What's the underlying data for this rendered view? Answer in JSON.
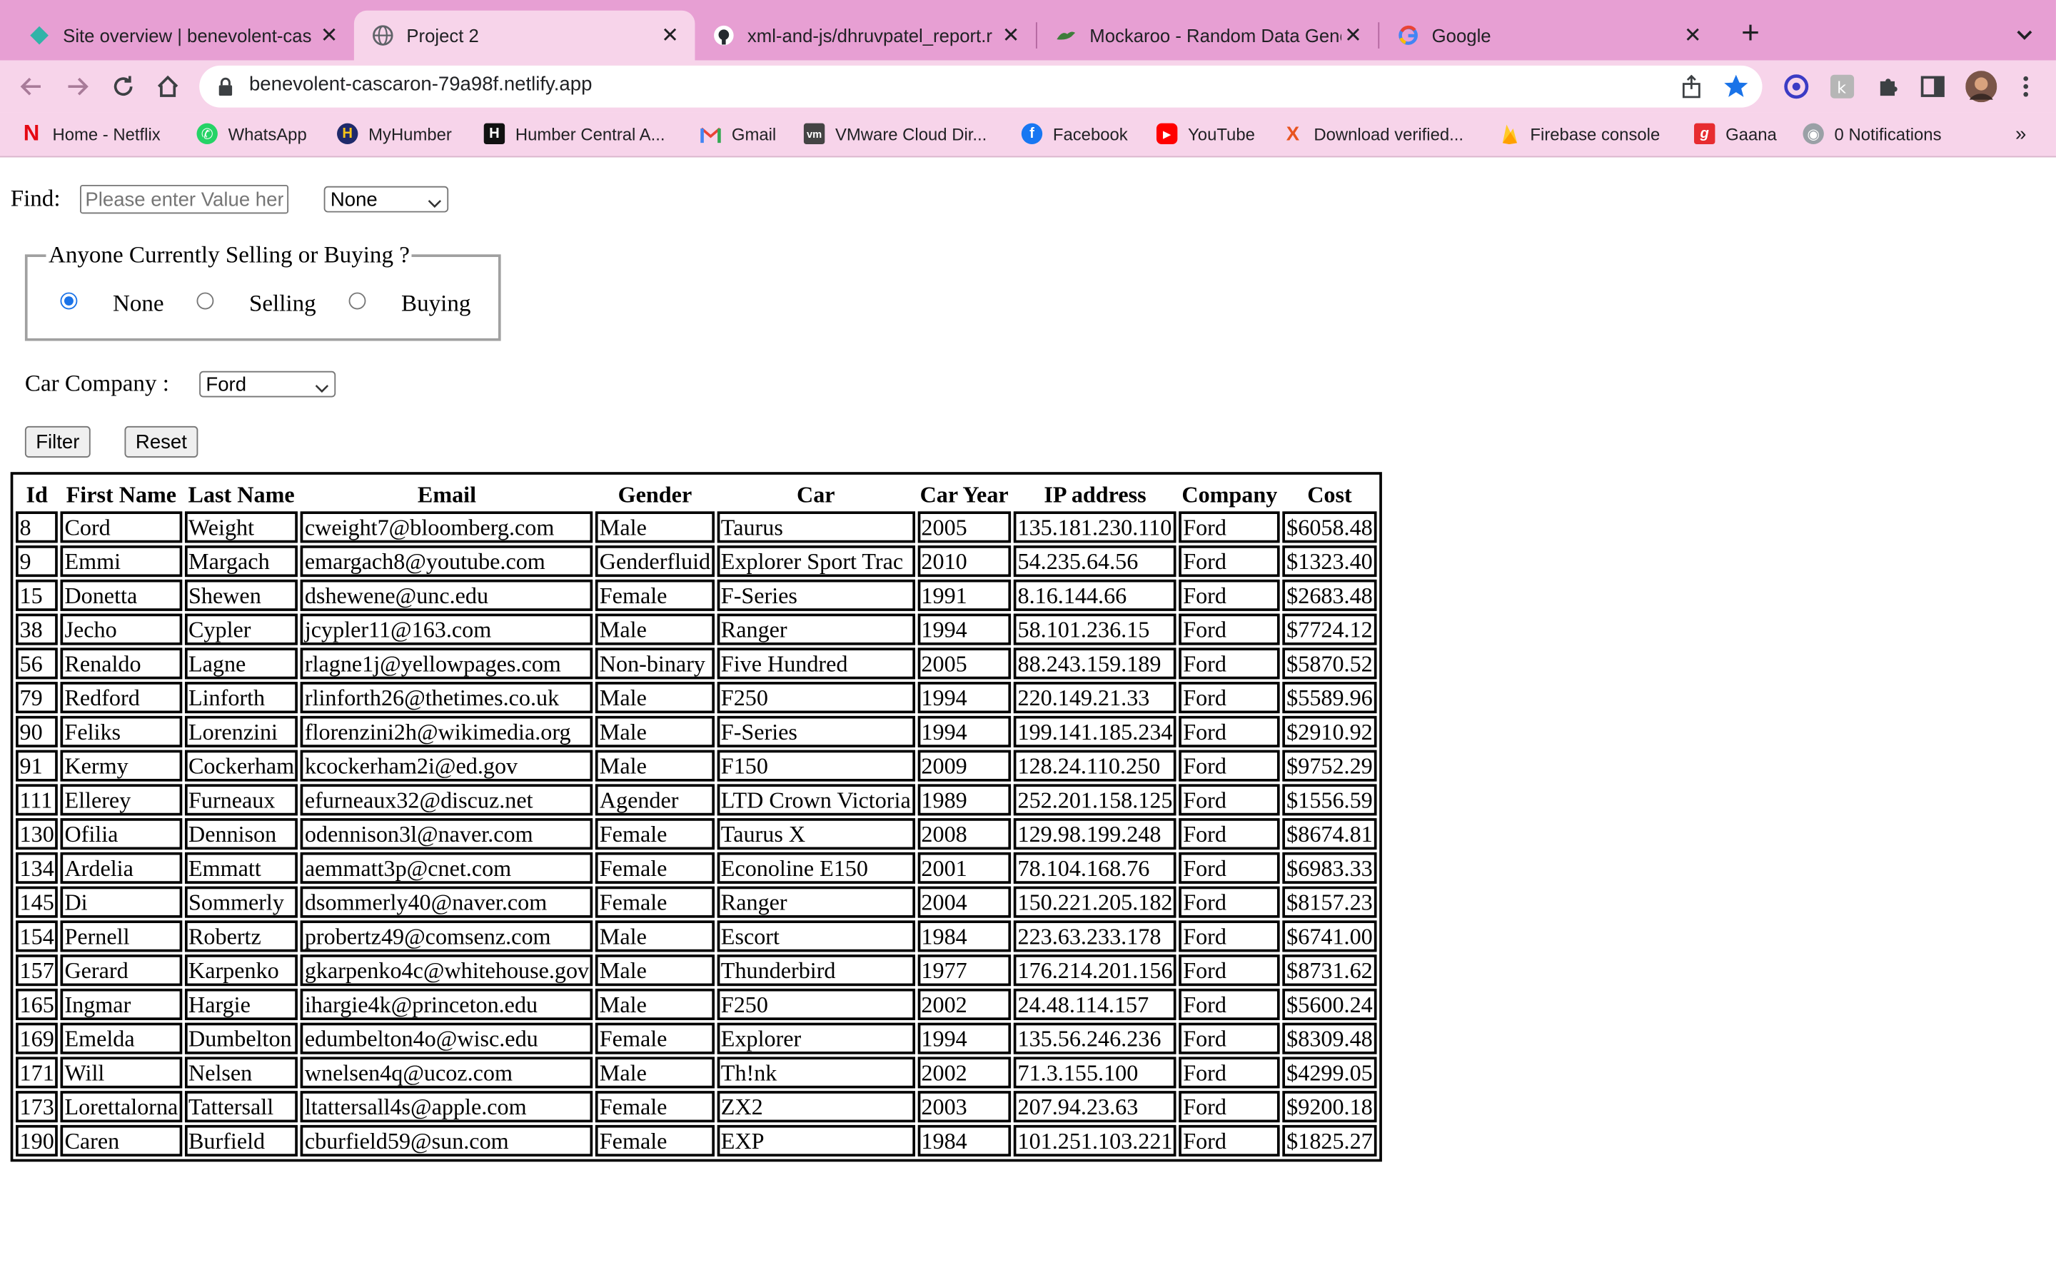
{
  "browser": {
    "tabs": [
      {
        "title": "Site overview | benevolent-cas",
        "icon": "netlify-icon",
        "active": false
      },
      {
        "title": "Project 2",
        "icon": "globe-icon",
        "active": true
      },
      {
        "title": "xml-and-js/dhruvpatel_report.r",
        "icon": "github-icon",
        "active": false
      },
      {
        "title": "Mockaroo - Random Data Gene",
        "icon": "mockaroo-icon",
        "active": false
      },
      {
        "title": "Google",
        "icon": "google-icon",
        "active": false
      }
    ],
    "new_tab_label": "+",
    "url": "benevolent-cascaron-79a98f.netlify.app",
    "bookmarks": [
      {
        "label": "Home - Netflix",
        "icon": "netflix-icon"
      },
      {
        "label": "WhatsApp",
        "icon": "whatsapp-icon"
      },
      {
        "label": "MyHumber",
        "icon": "humber-icon"
      },
      {
        "label": "Humber Central A...",
        "icon": "humber-central-icon"
      },
      {
        "label": "Gmail",
        "icon": "gmail-icon"
      },
      {
        "label": "VMware Cloud Dir...",
        "icon": "vmware-icon"
      },
      {
        "label": "Facebook",
        "icon": "facebook-icon"
      },
      {
        "label": "YouTube",
        "icon": "youtube-icon"
      },
      {
        "label": "Download verified...",
        "icon": "x-icon"
      },
      {
        "label": "Firebase console",
        "icon": "firebase-icon"
      },
      {
        "label": "Gaana",
        "icon": "gaana-icon"
      },
      {
        "label": "0 Notifications",
        "icon": "notifications-icon"
      }
    ],
    "bookmarks_overflow": "»",
    "colors": {
      "tabstrip": "#e79fd3",
      "toolbar": "#f7d4ea",
      "accent": "#1a73e8"
    }
  },
  "page": {
    "find_label": "Find:",
    "find_placeholder": "Please enter Value here",
    "find_field_select": "None",
    "group_legend": "Anyone Currently Selling or Buying ?",
    "radios": [
      {
        "label": "None",
        "checked": true
      },
      {
        "label": "Selling",
        "checked": false
      },
      {
        "label": "Buying",
        "checked": false
      }
    ],
    "car_company_label": "Car Company :",
    "car_company_value": "Ford",
    "filter_button": "Filter",
    "reset_button": "Reset",
    "table": {
      "headers": [
        "Id",
        "First Name",
        "Last Name",
        "Email",
        "Gender",
        "Car",
        "Car Year",
        "IP address",
        "Company",
        "Cost"
      ],
      "rows": [
        [
          "8",
          "Cord",
          "Weight",
          "cweight7@bloomberg.com",
          "Male",
          "Taurus",
          "2005",
          "135.181.230.110",
          "Ford",
          "$6058.48"
        ],
        [
          "9",
          "Emmi",
          "Margach",
          "emargach8@youtube.com",
          "Genderfluid",
          "Explorer Sport Trac",
          "2010",
          "54.235.64.56",
          "Ford",
          "$1323.40"
        ],
        [
          "15",
          "Donetta",
          "Shewen",
          "dshewene@unc.edu",
          "Female",
          "F-Series",
          "1991",
          "8.16.144.66",
          "Ford",
          "$2683.48"
        ],
        [
          "38",
          "Jecho",
          "Cypler",
          "jcypler11@163.com",
          "Male",
          "Ranger",
          "1994",
          "58.101.236.15",
          "Ford",
          "$7724.12"
        ],
        [
          "56",
          "Renaldo",
          "Lagne",
          "rlagne1j@yellowpages.com",
          "Non-binary",
          "Five Hundred",
          "2005",
          "88.243.159.189",
          "Ford",
          "$5870.52"
        ],
        [
          "79",
          "Redford",
          "Linforth",
          "rlinforth26@thetimes.co.uk",
          "Male",
          "F250",
          "1994",
          "220.149.21.33",
          "Ford",
          "$5589.96"
        ],
        [
          "90",
          "Feliks",
          "Lorenzini",
          "florenzini2h@wikimedia.org",
          "Male",
          "F-Series",
          "1994",
          "199.141.185.234",
          "Ford",
          "$2910.92"
        ],
        [
          "91",
          "Kermy",
          "Cockerham",
          "kcockerham2i@ed.gov",
          "Male",
          "F150",
          "2009",
          "128.24.110.250",
          "Ford",
          "$9752.29"
        ],
        [
          "111",
          "Ellerey",
          "Furneaux",
          "efurneaux32@discuz.net",
          "Agender",
          "LTD Crown Victoria",
          "1989",
          "252.201.158.125",
          "Ford",
          "$1556.59"
        ],
        [
          "130",
          "Ofilia",
          "Dennison",
          "odennison3l@naver.com",
          "Female",
          "Taurus X",
          "2008",
          "129.98.199.248",
          "Ford",
          "$8674.81"
        ],
        [
          "134",
          "Ardelia",
          "Emmatt",
          "aemmatt3p@cnet.com",
          "Female",
          "Econoline E150",
          "2001",
          "78.104.168.76",
          "Ford",
          "$6983.33"
        ],
        [
          "145",
          "Di",
          "Sommerly",
          "dsommerly40@naver.com",
          "Female",
          "Ranger",
          "2004",
          "150.221.205.182",
          "Ford",
          "$8157.23"
        ],
        [
          "154",
          "Pernell",
          "Robertz",
          "probertz49@comsenz.com",
          "Male",
          "Escort",
          "1984",
          "223.63.233.178",
          "Ford",
          "$6741.00"
        ],
        [
          "157",
          "Gerard",
          "Karpenko",
          "gkarpenko4c@whitehouse.gov",
          "Male",
          "Thunderbird",
          "1977",
          "176.214.201.156",
          "Ford",
          "$8731.62"
        ],
        [
          "165",
          "Ingmar",
          "Hargie",
          "ihargie4k@princeton.edu",
          "Male",
          "F250",
          "2002",
          "24.48.114.157",
          "Ford",
          "$5600.24"
        ],
        [
          "169",
          "Emelda",
          "Dumbelton",
          "edumbelton4o@wisc.edu",
          "Female",
          "Explorer",
          "1994",
          "135.56.246.236",
          "Ford",
          "$8309.48"
        ],
        [
          "171",
          "Will",
          "Nelsen",
          "wnelsen4q@ucoz.com",
          "Male",
          "Th!nk",
          "2002",
          "71.3.155.100",
          "Ford",
          "$4299.05"
        ],
        [
          "173",
          "Lorettalorna",
          "Tattersall",
          "ltattersall4s@apple.com",
          "Female",
          "ZX2",
          "2003",
          "207.94.23.63",
          "Ford",
          "$9200.18"
        ],
        [
          "190",
          "Caren",
          "Burfield",
          "cburfield59@sun.com",
          "Female",
          "EXP",
          "1984",
          "101.251.103.221",
          "Ford",
          "$1825.27"
        ]
      ]
    }
  }
}
